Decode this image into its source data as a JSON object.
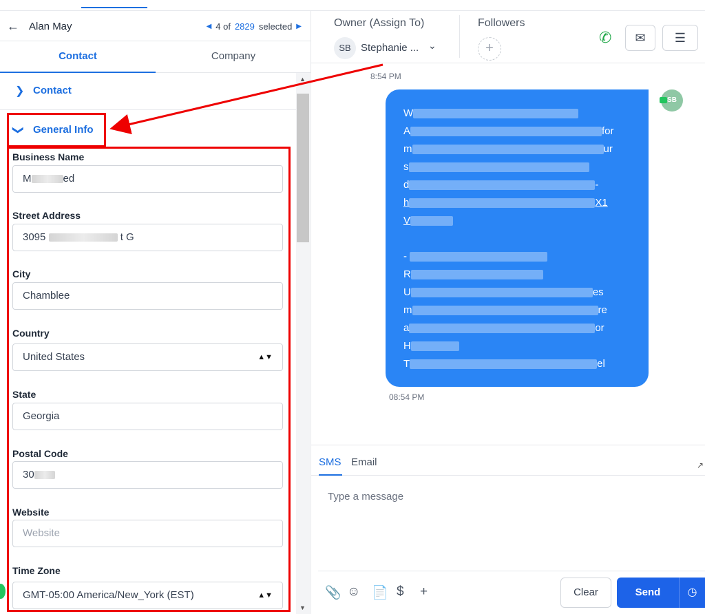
{
  "header": {
    "contact_name": "Alan May",
    "pager_position": "4 of",
    "pager_total": "2829",
    "pager_suffix": "selected"
  },
  "tabs": [
    {
      "label": "Contact",
      "active": true
    },
    {
      "label": "Company",
      "active": false
    }
  ],
  "sections": {
    "contact": "Contact",
    "general_info": "General Info"
  },
  "fields": {
    "business_name": {
      "label": "Business Name",
      "value_start": "M",
      "value_end": "ed"
    },
    "street_address": {
      "label": "Street Address",
      "value_start": "3095",
      "value_end": "t G"
    },
    "city": {
      "label": "City",
      "value": "Chamblee"
    },
    "country": {
      "label": "Country",
      "value": "United States"
    },
    "state": {
      "label": "State",
      "value": "Georgia"
    },
    "postal_code": {
      "label": "Postal Code",
      "value_start": "30"
    },
    "website": {
      "label": "Website",
      "placeholder": "Website"
    },
    "time_zone": {
      "label": "Time Zone",
      "value": "GMT-05:00 America/New_York (EST)"
    }
  },
  "right_header": {
    "owner_label": "Owner (Assign To)",
    "owner_initials": "SB",
    "owner_name": "Stephanie ...",
    "followers_label": "Followers"
  },
  "thread": {
    "timestamp_top": "8:54 PM",
    "timestamp_bottom": "08:54 PM",
    "sender_initials": "SB",
    "message_lines": [
      {
        "start": "W",
        "end": ""
      },
      {
        "start": "A",
        "end": "for"
      },
      {
        "start": "m",
        "end": "ur"
      },
      {
        "start": "s",
        "end": ""
      },
      {
        "start": "d",
        "end": "-"
      },
      {
        "start": "h",
        "end": "X1",
        "link": true
      },
      {
        "start": "V",
        "end": ""
      },
      {
        "start": "",
        "end": ""
      },
      {
        "start": "-",
        "end": ""
      },
      {
        "start": "R",
        "end": ""
      },
      {
        "start": "U",
        "end": "es"
      },
      {
        "start": "m",
        "end": "re"
      },
      {
        "start": "a",
        "end": "or"
      },
      {
        "start": "H",
        "end": ""
      },
      {
        "start": "T",
        "end": "el"
      }
    ]
  },
  "composer": {
    "tab_sms": "SMS",
    "tab_email": "Email",
    "placeholder": "Type a message",
    "clear_label": "Clear",
    "send_label": "Send"
  },
  "icons": {
    "back": "arrow-left-icon",
    "phone": "phone-icon",
    "mail": "envelope-icon",
    "filter": "filter-icon"
  },
  "colors": {
    "accent": "#1d6fe0",
    "bubble": "#2a85f5",
    "send": "#1d63e8",
    "annotation": "#ee0000"
  }
}
